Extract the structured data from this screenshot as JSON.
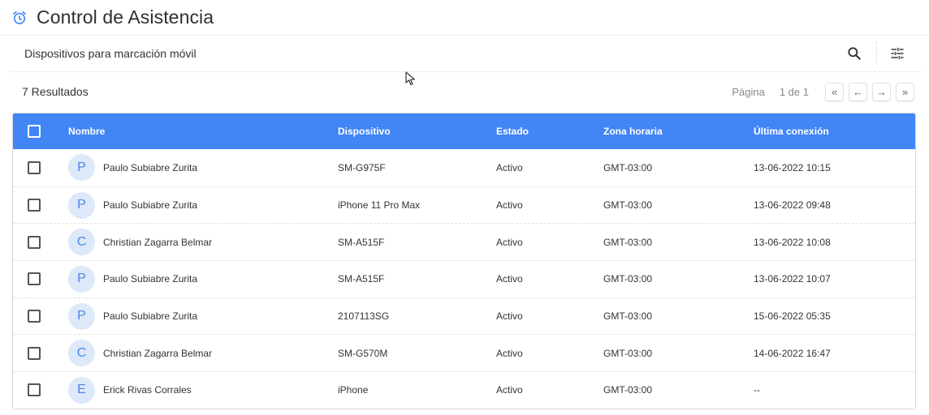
{
  "header": {
    "title": "Control de Asistencia",
    "icon": "alarm-clock-icon",
    "accent_color": "#4285f4"
  },
  "toolbar": {
    "title": "Dispositivos para marcación móvil",
    "search_icon": "search-icon",
    "filter_icon": "tune-icon"
  },
  "results": {
    "count_label": "7 Resultados",
    "page_label": "Página",
    "page_info": "1 de 1",
    "first_label": "«",
    "prev_label": "←",
    "next_label": "→",
    "last_label": "»"
  },
  "table": {
    "header_color": "#4285f4",
    "columns": {
      "name": "Nombre",
      "device": "Dispositivo",
      "status": "Estado",
      "timezone": "Zona horaria",
      "last_connection": "Última conexión"
    },
    "rows": [
      {
        "initial": "P",
        "name": "Paulo Subiabre Zurita",
        "device": "SM-G975F",
        "status": "Activo",
        "timezone": "GMT-03:00",
        "last_connection": "13-06-2022 10:15"
      },
      {
        "initial": "P",
        "name": "Paulo Subiabre Zurita",
        "device": "iPhone 11 Pro Max",
        "status": "Activo",
        "timezone": "GMT-03:00",
        "last_connection": "13-06-2022 09:48"
      },
      {
        "initial": "C",
        "name": "Christian Zagarra Belmar",
        "device": "SM-A515F",
        "status": "Activo",
        "timezone": "GMT-03:00",
        "last_connection": "13-06-2022 10:08"
      },
      {
        "initial": "P",
        "name": "Paulo Subiabre Zurita",
        "device": "SM-A515F",
        "status": "Activo",
        "timezone": "GMT-03:00",
        "last_connection": "13-06-2022 10:07"
      },
      {
        "initial": "P",
        "name": "Paulo Subiabre Zurita",
        "device": "2107113SG",
        "status": "Activo",
        "timezone": "GMT-03:00",
        "last_connection": "15-06-2022 05:35"
      },
      {
        "initial": "C",
        "name": "Christian Zagarra Belmar",
        "device": "SM-G570M",
        "status": "Activo",
        "timezone": "GMT-03:00",
        "last_connection": "14-06-2022 16:47"
      },
      {
        "initial": "E",
        "name": "Erick Rivas Corrales",
        "device": "iPhone",
        "status": "Activo",
        "timezone": "GMT-03:00",
        "last_connection": "--"
      }
    ]
  }
}
